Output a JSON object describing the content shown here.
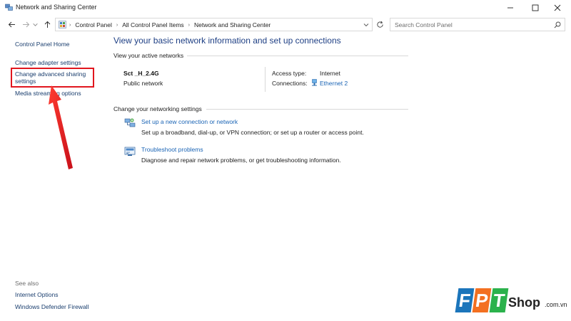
{
  "window": {
    "title": "Network and Sharing Center",
    "controls": [
      "minimize-icon",
      "maximize-icon",
      "close-icon"
    ]
  },
  "address": {
    "crumbs": [
      "Control Panel",
      "All Control Panel Items",
      "Network and Sharing Center"
    ],
    "search_placeholder": "Search Control Panel"
  },
  "sidebar": {
    "home": "Control Panel Home",
    "items": [
      {
        "label": "Change adapter settings"
      },
      {
        "label_line1": "Change advanced sharing",
        "label_line2": "settings"
      },
      {
        "label": "Media streaming options"
      }
    ],
    "see_also_label": "See also",
    "see_also": [
      "Internet Options",
      "Windows Defender Firewall"
    ]
  },
  "main": {
    "title": "View your basic network information and set up connections",
    "active_label": "View your active networks",
    "network": {
      "name": "Sct _H_2.4G",
      "type": "Public network",
      "access_label": "Access type:",
      "access_value": "Internet",
      "connections_label": "Connections:",
      "connections_value": "Ethernet 2"
    },
    "change_label": "Change your networking settings",
    "tasks": [
      {
        "link": "Set up a new connection or network",
        "desc": "Set up a broadband, dial-up, or VPN connection; or set up a router or access point.",
        "icon": "network-setup-icon"
      },
      {
        "link": "Troubleshoot problems",
        "desc": "Diagnose and repair network problems, or get troubleshooting information.",
        "icon": "troubleshoot-icon"
      }
    ]
  },
  "annotation": {
    "highlight_color": "#e1161e"
  },
  "brand": {
    "letters": [
      "F",
      "P",
      "T"
    ],
    "letter_colors": [
      "#1b75bb",
      "#f37021",
      "#2bb24c"
    ],
    "shop": "Shop",
    "domain": ".com.vn"
  }
}
